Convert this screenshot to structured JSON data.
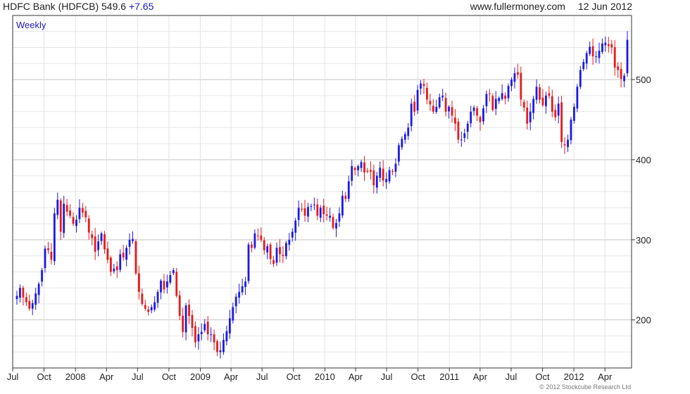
{
  "header": {
    "title": "HDFC Bank (HDFCB) 549.6",
    "change": "+7.65",
    "site": "www.fullermoney.com",
    "date": "12 Jun 2012"
  },
  "copyright": "© 2012 Stockcube Research Ltd",
  "colors": {
    "up": "#1a1ae6",
    "down": "#e61a1a",
    "grid": "#d8d8d8",
    "axis": "#333333",
    "period_label": "#1a1ab4"
  },
  "chart_data": {
    "type": "candlestick",
    "period_label": "Weekly",
    "x_range": [
      "2007-07-01",
      "2012-06-18"
    ],
    "ylim": [
      140,
      580
    ],
    "yticks": [
      200,
      300,
      400,
      500
    ],
    "y_axis_side": "right",
    "grid": true,
    "x_ticks": [
      {
        "date": "2007-07-01",
        "label": "Jul"
      },
      {
        "date": "2007-10-01",
        "label": "Oct"
      },
      {
        "date": "2008-01-01",
        "label": "2008"
      },
      {
        "date": "2008-04-01",
        "label": "Apr"
      },
      {
        "date": "2008-07-01",
        "label": "Jul"
      },
      {
        "date": "2008-10-01",
        "label": "Oct"
      },
      {
        "date": "2009-01-01",
        "label": "2009"
      },
      {
        "date": "2009-04-01",
        "label": "Apr"
      },
      {
        "date": "2009-07-01",
        "label": "Jul"
      },
      {
        "date": "2009-10-01",
        "label": "Oct"
      },
      {
        "date": "2010-01-01",
        "label": "2010"
      },
      {
        "date": "2010-04-01",
        "label": "Apr"
      },
      {
        "date": "2010-07-01",
        "label": "Jul"
      },
      {
        "date": "2010-10-01",
        "label": "Oct"
      },
      {
        "date": "2011-01-01",
        "label": "2011"
      },
      {
        "date": "2011-04-01",
        "label": "Apr"
      },
      {
        "date": "2011-07-01",
        "label": "Jul"
      },
      {
        "date": "2011-10-01",
        "label": "Oct"
      },
      {
        "date": "2012-01-01",
        "label": "2012"
      },
      {
        "date": "2012-04-01",
        "label": "Apr"
      }
    ],
    "closes": [
      230,
      240,
      228,
      222,
      214,
      221,
      233,
      245,
      262,
      289,
      287,
      275,
      333,
      350,
      310,
      345,
      335,
      330,
      320,
      325,
      340,
      334,
      328,
      309,
      302,
      285,
      298,
      308,
      288,
      275,
      260,
      264,
      262,
      282,
      278,
      290,
      300,
      301,
      258,
      235,
      220,
      214,
      210,
      216,
      222,
      235,
      249,
      238,
      248,
      256,
      262,
      230,
      205,
      185,
      218,
      205,
      190,
      172,
      182,
      185,
      195,
      182,
      182,
      172,
      160,
      162,
      175,
      186,
      202,
      216,
      229,
      235,
      242,
      248,
      294,
      290,
      308,
      305,
      300,
      287,
      292,
      276,
      270,
      290,
      282,
      280,
      296,
      300,
      310,
      324,
      340,
      338,
      330,
      341,
      342,
      344,
      330,
      340,
      332,
      330,
      330,
      315,
      321,
      333,
      355,
      351,
      373,
      392,
      387,
      392,
      397,
      384,
      385,
      385,
      368,
      380,
      390,
      374,
      376,
      387,
      385,
      395,
      418,
      426,
      432,
      440,
      470,
      460,
      487,
      495,
      492,
      475,
      469,
      460,
      466,
      478,
      480,
      460,
      466,
      455,
      445,
      425,
      425,
      433,
      445,
      460,
      465,
      455,
      447,
      464,
      482,
      482,
      462,
      476,
      477,
      483,
      476,
      492,
      500,
      508,
      506,
      475,
      465,
      445,
      460,
      476,
      491,
      475,
      468,
      480,
      480,
      460,
      453,
      470,
      422,
      418,
      425,
      450,
      466,
      491,
      512,
      522,
      533,
      541,
      529,
      529,
      536,
      545,
      546,
      542,
      540,
      515,
      512,
      501,
      505,
      549.6
    ]
  }
}
